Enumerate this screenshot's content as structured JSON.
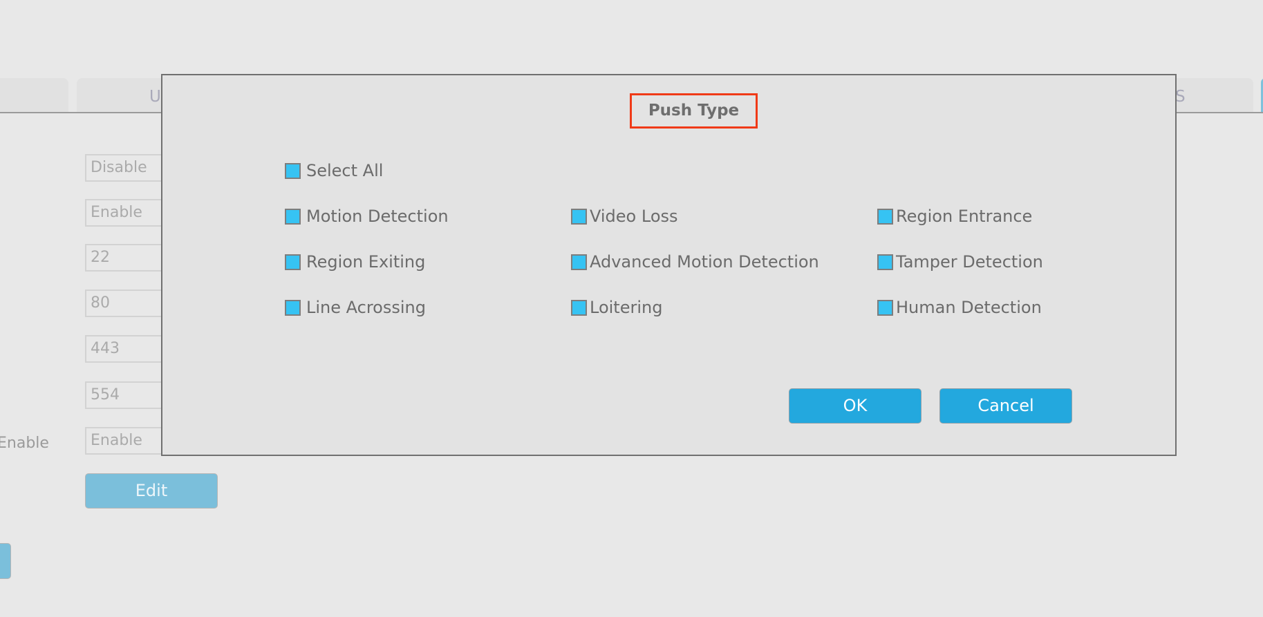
{
  "tabs": [
    {
      "label": ""
    },
    {
      "label": "U"
    },
    {
      "label": "S"
    },
    {
      "label": ""
    }
  ],
  "background_form": {
    "fields": [
      "Disable",
      "Enable",
      "22",
      "80",
      "443",
      "554",
      "Enable"
    ],
    "side_label": "Enable",
    "edit_label": "Edit"
  },
  "dialog": {
    "title": "Push Type",
    "select_all": {
      "label": "Select All",
      "checked": true
    },
    "options": [
      {
        "label": "Motion Detection",
        "checked": true
      },
      {
        "label": "Video Loss",
        "checked": true
      },
      {
        "label": "Region Entrance",
        "checked": true
      },
      {
        "label": "Region Exiting",
        "checked": true
      },
      {
        "label": "Advanced Motion Detection",
        "checked": true
      },
      {
        "label": "Tamper Detection",
        "checked": true
      },
      {
        "label": "Line Acrossing",
        "checked": true
      },
      {
        "label": "Loitering",
        "checked": true
      },
      {
        "label": "Human Detection",
        "checked": true
      }
    ],
    "ok_label": "OK",
    "cancel_label": "Cancel"
  },
  "colors": {
    "accent": "#23a8de",
    "checkbox_fill": "#36c3f3",
    "title_highlight": "#f03a17"
  }
}
